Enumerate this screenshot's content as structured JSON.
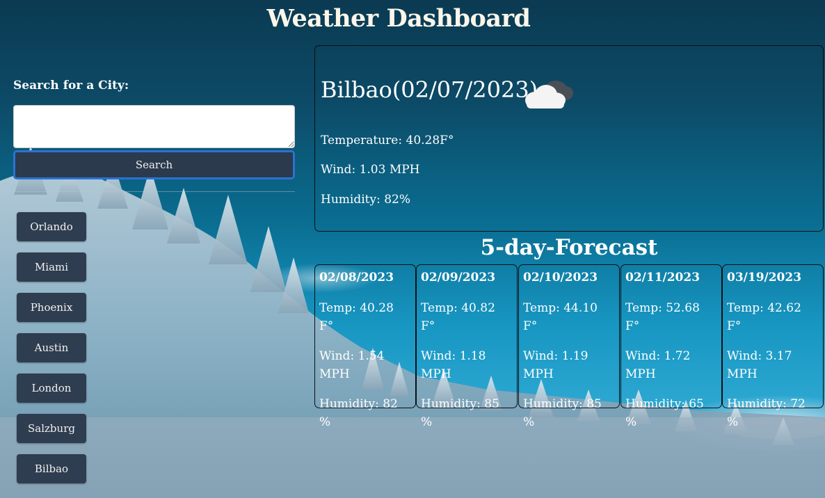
{
  "header": {
    "title": "Weather Dashboard"
  },
  "search": {
    "label": "Search for a City:",
    "input_value": "",
    "button_label": "Search"
  },
  "history": [
    "Orlando",
    "Miami",
    "Phoenix",
    "Austin",
    "London",
    "Salzburg",
    "Bilbao"
  ],
  "current": {
    "heading": "Bilbao(02/07/2023)",
    "icon": "cloudy-icon",
    "temperature": "Temperature: 40.28F°",
    "wind": "Wind: 1.03 MPH",
    "humidity": "Humidity: 82%"
  },
  "forecast": {
    "title": "5-day-Forecast",
    "days": [
      {
        "date": "02/08/2023",
        "temp": "Temp: 40.28 F°",
        "wind": "Wind: 1.54 MPH",
        "humidity": "Humidity: 82 %"
      },
      {
        "date": "02/09/2023",
        "temp": "Temp: 40.82 F°",
        "wind": "Wind: 1.18 MPH",
        "humidity": "Humidity: 85 %"
      },
      {
        "date": "02/10/2023",
        "temp": "Temp: 44.10 F°",
        "wind": "Wind: 1.19 MPH",
        "humidity": "Humidity: 85 %"
      },
      {
        "date": "02/11/2023",
        "temp": "Temp: 52.68 F°",
        "wind": "Wind: 1.72 MPH",
        "humidity": "Humidity: 65 %"
      },
      {
        "date": "03/19/2023",
        "temp": "Temp: 42.62 F°",
        "wind": "Wind: 3.17 MPH",
        "humidity": "Humidity: 72 %"
      }
    ]
  },
  "colors": {
    "button_bg": "#2c3a4d",
    "focus_ring": "#2a73d0",
    "title": "#fbf6ea"
  }
}
